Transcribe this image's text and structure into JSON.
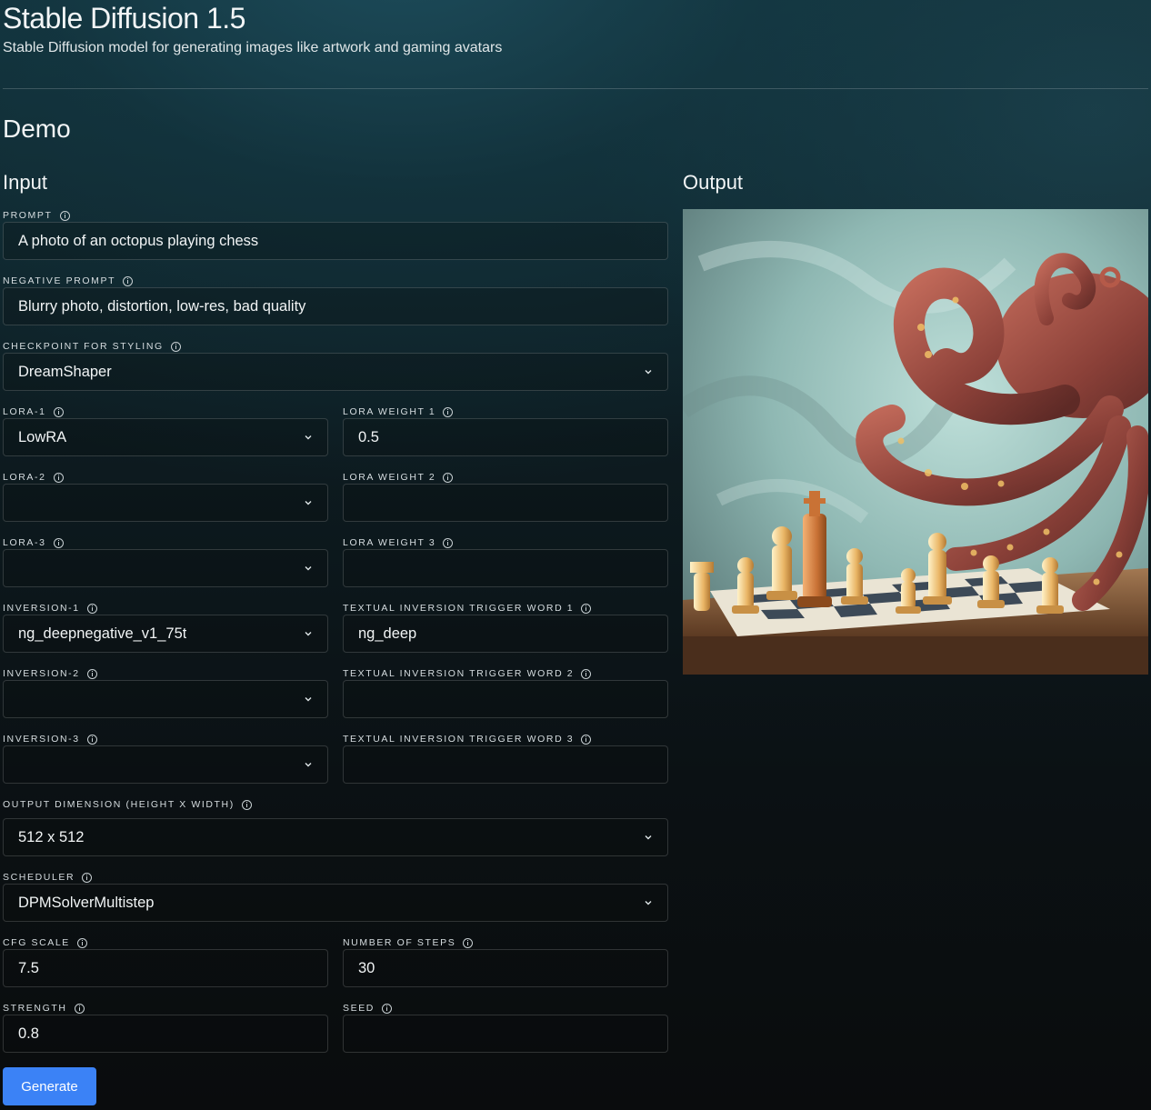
{
  "header": {
    "title": "Stable Diffusion 1.5",
    "subtitle": "Stable Diffusion model for generating images like artwork and gaming avatars"
  },
  "demo": {
    "heading": "Demo",
    "input_heading": "Input",
    "output_heading": "Output"
  },
  "fields": {
    "prompt": {
      "label": "Prompt",
      "value": "A photo of an octopus playing chess"
    },
    "negative_prompt": {
      "label": "Negative Prompt",
      "value": "Blurry photo, distortion, low-res, bad quality"
    },
    "checkpoint": {
      "label": "Checkpoint for styling",
      "value": "DreamShaper"
    },
    "lora_1": {
      "label": "Lora-1",
      "value": "LowRA"
    },
    "lora_weight_1": {
      "label": "Lora Weight 1",
      "value": "0.5"
    },
    "lora_2": {
      "label": "Lora-2",
      "value": ""
    },
    "lora_weight_2": {
      "label": "Lora Weight 2",
      "value": ""
    },
    "lora_3": {
      "label": "Lora-3",
      "value": ""
    },
    "lora_weight_3": {
      "label": "Lora Weight 3",
      "value": ""
    },
    "inversion_1": {
      "label": "Inversion-1",
      "value": "ng_deepnegative_v1_75t"
    },
    "trigger_word_1": {
      "label": "Textual Inversion Trigger Word 1",
      "value": "ng_deep"
    },
    "inversion_2": {
      "label": "Inversion-2",
      "value": ""
    },
    "trigger_word_2": {
      "label": "Textual Inversion Trigger Word 2",
      "value": ""
    },
    "inversion_3": {
      "label": "Inversion-3",
      "value": ""
    },
    "trigger_word_3": {
      "label": "Textual Inversion Trigger Word 3",
      "value": ""
    },
    "output_dimension": {
      "label": "Output Dimension (Height x Width)",
      "value": "512 x 512"
    },
    "scheduler": {
      "label": "Scheduler",
      "value": "DPMSolverMultistep"
    },
    "cfg_scale": {
      "label": "CFG Scale",
      "value": "7.5"
    },
    "num_steps": {
      "label": "Number of steps",
      "value": "30"
    },
    "strength": {
      "label": "Strength",
      "value": "0.8"
    },
    "seed": {
      "label": "Seed",
      "value": ""
    }
  },
  "actions": {
    "generate_label": "Generate"
  },
  "icons": {
    "info": "info-icon",
    "chevron": "chevron-down-icon"
  },
  "colors": {
    "accent": "#3b82f6",
    "field_border": "#2b3336",
    "text": "#f1f4f5"
  }
}
